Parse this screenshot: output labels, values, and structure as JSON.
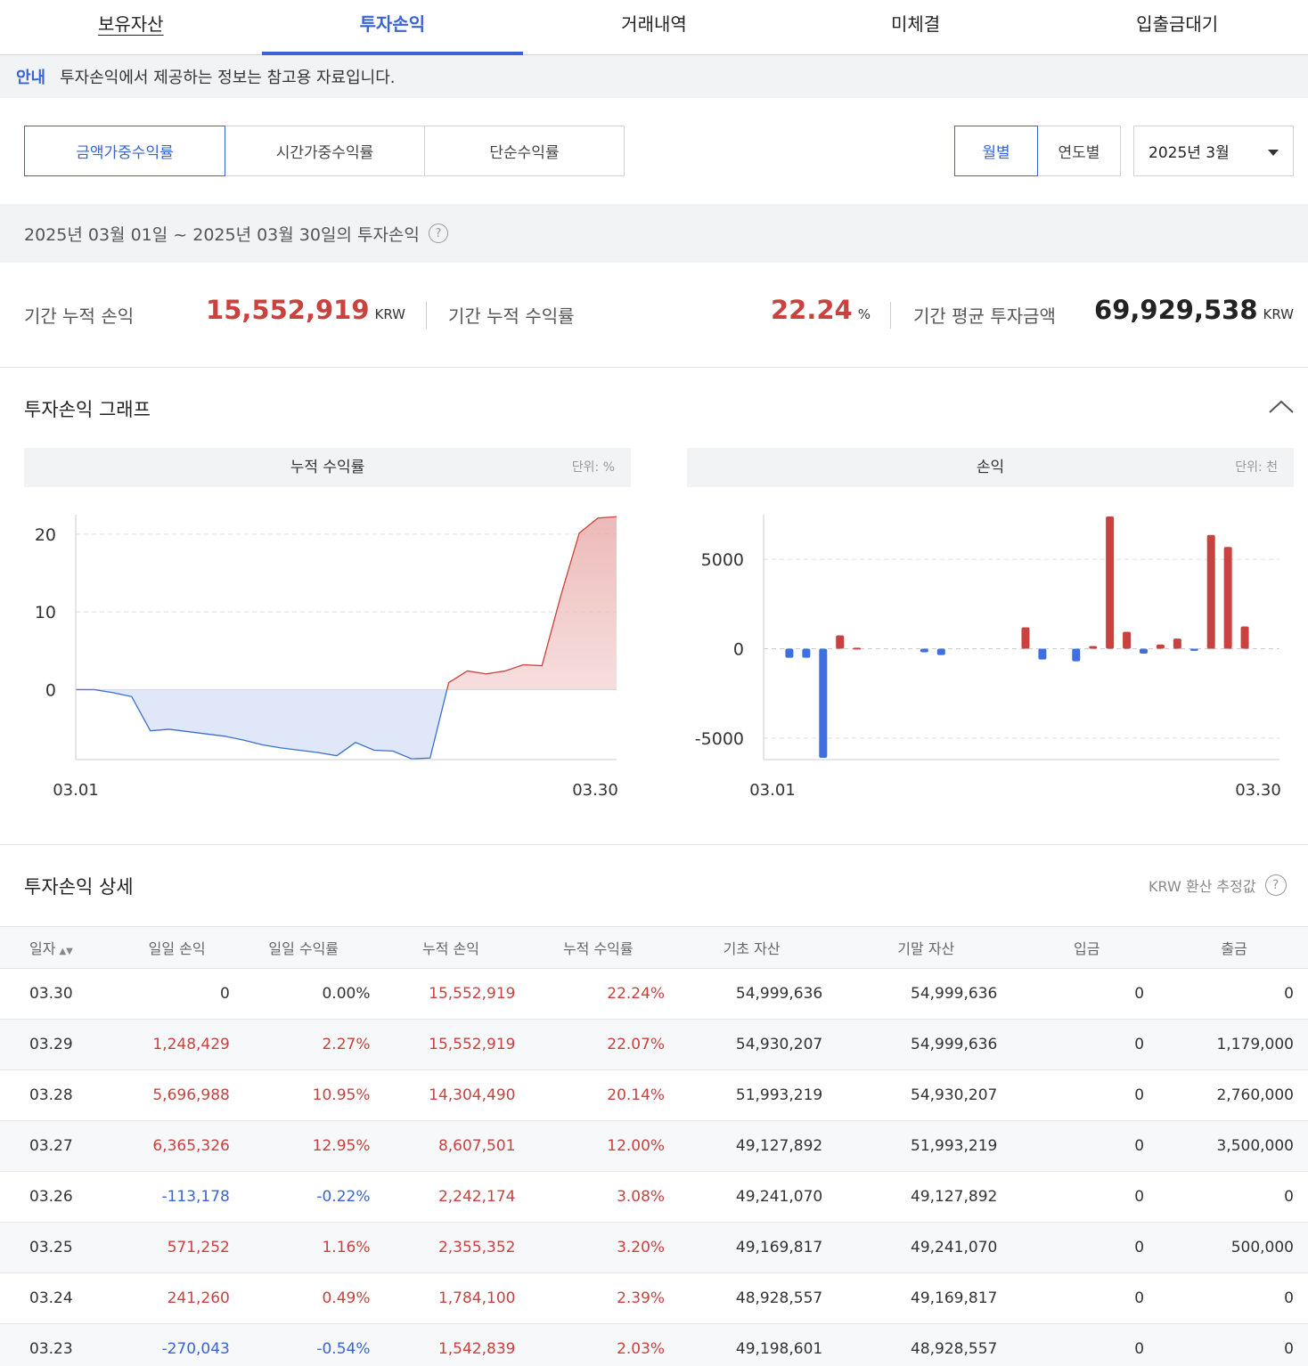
{
  "tabs": [
    {
      "label": "보유자산"
    },
    {
      "label": "투자손익"
    },
    {
      "label": "거래내역"
    },
    {
      "label": "미체결"
    },
    {
      "label": "입출금대기"
    }
  ],
  "notice": {
    "badge": "안내",
    "text": "투자손익에서 제공하는 정보는 참고용 자료입니다."
  },
  "rate_options": [
    "금액가중수익률",
    "시간가중수익률",
    "단순수익률"
  ],
  "period_options": [
    "월별",
    "연도별"
  ],
  "month_select": "2025년 3월",
  "period_heading": "2025년 03월 01일 ~ 2025년 03월 30일의 투자손익",
  "summary": {
    "cum_pnl_label": "기간 누적 손익",
    "cum_pnl_value": "15,552,919",
    "cum_pnl_unit": "KRW",
    "cum_rate_label": "기간 누적 수익률",
    "cum_rate_value": "22.24",
    "cum_rate_unit": "%",
    "avg_invest_label": "기간 평균 투자금액",
    "avg_invest_value": "69,929,538",
    "avg_invest_unit": "KRW"
  },
  "graph_section_title": "투자손익 그래프",
  "detail_section_title": "투자손익 상세",
  "krw_note": "KRW 환산 추정값",
  "colors": {
    "accent": "#3a63d8",
    "profit": "#c9423f",
    "loss": "#3a63d8"
  },
  "chart_data": [
    {
      "type": "area",
      "title": "누적 수익률",
      "unit_label": "단위: %",
      "x_tick_labels": [
        "03.01",
        "03.30"
      ],
      "y_ticks": [
        20,
        10,
        0
      ],
      "ylim": [
        -9,
        22.5
      ],
      "grid": true,
      "x": [
        "03.01",
        "03.02",
        "03.03",
        "03.04",
        "03.05",
        "03.06",
        "03.07",
        "03.08",
        "03.09",
        "03.10",
        "03.11",
        "03.12",
        "03.13",
        "03.14",
        "03.15",
        "03.16",
        "03.17",
        "03.18",
        "03.19",
        "03.20",
        "03.21",
        "03.22",
        "03.23",
        "03.24",
        "03.25",
        "03.26",
        "03.27",
        "03.28",
        "03.29",
        "03.30"
      ],
      "values": [
        0,
        0,
        -0.4,
        -0.9,
        -5.3,
        -5.1,
        -5.4,
        -5.7,
        -6.0,
        -6.5,
        -7.1,
        -7.5,
        -7.8,
        -8.1,
        -8.5,
        -6.8,
        -7.8,
        -7.9,
        -8.9,
        -8.8,
        0.9,
        2.4,
        2.03,
        2.39,
        3.2,
        3.08,
        12.0,
        20.14,
        22.07,
        22.24
      ]
    },
    {
      "type": "bar",
      "title": "손익",
      "unit_label": "단위: 천",
      "x_tick_labels": [
        "03.01",
        "03.30"
      ],
      "y_ticks": [
        5000,
        0,
        -5000
      ],
      "ylim": [
        -6200,
        7500
      ],
      "grid": true,
      "x": [
        "03.01",
        "03.02",
        "03.03",
        "03.04",
        "03.05",
        "03.06",
        "03.07",
        "03.08",
        "03.09",
        "03.10",
        "03.11",
        "03.12",
        "03.13",
        "03.14",
        "03.15",
        "03.16",
        "03.17",
        "03.18",
        "03.19",
        "03.20",
        "03.21",
        "03.22",
        "03.23",
        "03.24",
        "03.25",
        "03.26",
        "03.27",
        "03.28",
        "03.29",
        "03.30"
      ],
      "values": [
        0,
        -500,
        -500,
        -6100,
        750,
        60,
        0,
        0,
        0,
        -200,
        -350,
        0,
        0,
        0,
        0,
        1200,
        -600,
        0,
        -700,
        150,
        7400,
        950,
        -270,
        241,
        571,
        -113,
        6365,
        5697,
        1248,
        0
      ]
    }
  ],
  "table": {
    "headers": [
      "일자",
      "일일 손익",
      "일일 수익률",
      "누적 손익",
      "누적 수익률",
      "기초 자산",
      "기말 자산",
      "입금",
      "출금"
    ],
    "rows": [
      [
        "03.30",
        "0",
        "0.00%",
        "15,552,919",
        "22.24%",
        "54,999,636",
        "54,999,636",
        "0",
        "0"
      ],
      [
        "03.29",
        "1,248,429",
        "2.27%",
        "15,552,919",
        "22.07%",
        "54,930,207",
        "54,999,636",
        "0",
        "1,179,000"
      ],
      [
        "03.28",
        "5,696,988",
        "10.95%",
        "14,304,490",
        "20.14%",
        "51,993,219",
        "54,930,207",
        "0",
        "2,760,000"
      ],
      [
        "03.27",
        "6,365,326",
        "12.95%",
        "8,607,501",
        "12.00%",
        "49,127,892",
        "51,993,219",
        "0",
        "3,500,000"
      ],
      [
        "03.26",
        "-113,178",
        "-0.22%",
        "2,242,174",
        "3.08%",
        "49,241,070",
        "49,127,892",
        "0",
        "0"
      ],
      [
        "03.25",
        "571,252",
        "1.16%",
        "2,355,352",
        "3.20%",
        "49,169,817",
        "49,241,070",
        "0",
        "500,000"
      ],
      [
        "03.24",
        "241,260",
        "0.49%",
        "1,784,100",
        "2.39%",
        "48,928,557",
        "49,169,817",
        "0",
        "0"
      ],
      [
        "03.23",
        "-270,043",
        "-0.54%",
        "1,542,839",
        "2.03%",
        "49,198,601",
        "48,928,557",
        "0",
        "0"
      ]
    ]
  }
}
